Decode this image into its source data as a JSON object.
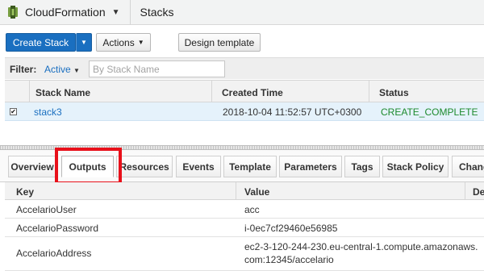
{
  "header": {
    "service": "CloudFormation",
    "breadcrumb": "Stacks"
  },
  "toolbar": {
    "create_stack": "Create Stack",
    "actions": "Actions",
    "design_template": "Design template"
  },
  "filter": {
    "label": "Filter:",
    "active": "Active",
    "placeholder": "By Stack Name"
  },
  "stacks_table": {
    "columns": [
      "Stack Name",
      "Created Time",
      "Status"
    ],
    "rows": [
      {
        "checked": true,
        "name": "stack3",
        "created": "2018-10-04 11:52:57 UTC+0300",
        "status": "CREATE_COMPLETE"
      }
    ]
  },
  "detail_tabs": [
    "Overview",
    "Outputs",
    "Resources",
    "Events",
    "Template",
    "Parameters",
    "Tags",
    "Stack Policy",
    "Chang"
  ],
  "active_tab": "Outputs",
  "outputs_table": {
    "columns": [
      "Key",
      "Value",
      "De"
    ],
    "rows": [
      {
        "key": "AccelarioUser",
        "value": "acc",
        "value_line2": ""
      },
      {
        "key": "AccelarioPassword",
        "value": "i-0ec7cf29460e56985",
        "value_line2": ""
      },
      {
        "key": "AccelarioAddress",
        "value": "ec2-3-120-244-230.eu-central-1.compute.amazonaws.",
        "value_line2": "com:12345/accelario"
      }
    ]
  },
  "colors": {
    "primary": "#1a6fc0",
    "success": "#1d8a2d",
    "highlight": "#e8101a",
    "selected_row": "#e5f2fb"
  }
}
